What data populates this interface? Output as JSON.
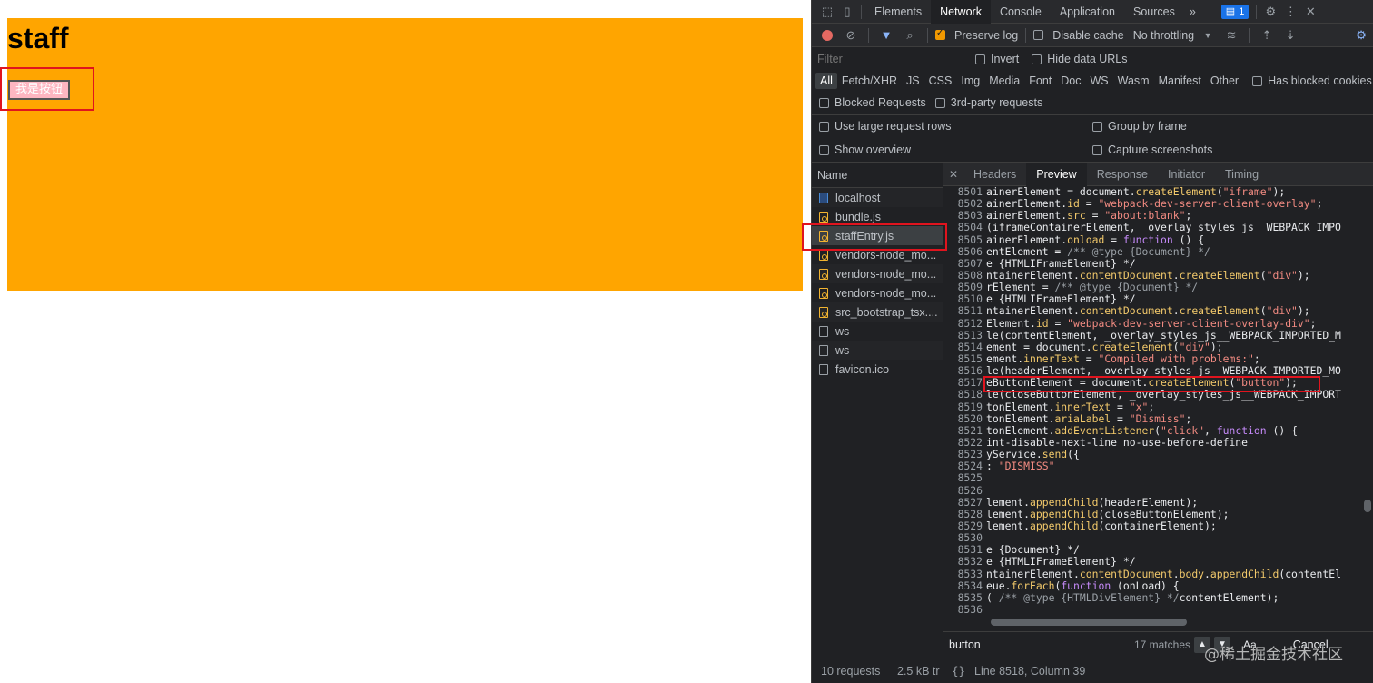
{
  "page": {
    "title": "staff",
    "button_label": "我是按钮"
  },
  "devtools": {
    "tabs": [
      "Elements",
      "Network",
      "Console",
      "Application",
      "Sources"
    ],
    "active_tab": "Network",
    "more_tabs_label": "»",
    "issues_count": "1",
    "toolbar": {
      "preserve_log": "Preserve log",
      "disable_cache": "Disable cache",
      "throttling": "No throttling"
    },
    "filter": {
      "placeholder": "Filter",
      "invert": "Invert",
      "hide_data_urls": "Hide data URLs"
    },
    "types": [
      "All",
      "Fetch/XHR",
      "JS",
      "CSS",
      "Img",
      "Media",
      "Font",
      "Doc",
      "WS",
      "Wasm",
      "Manifest",
      "Other"
    ],
    "has_blocked_cookies": "Has blocked cookies",
    "blocked_requests": "Blocked Requests",
    "third_party": "3rd-party requests",
    "options": {
      "large_rows": "Use large request rows",
      "group_by_frame": "Group by frame",
      "show_overview": "Show overview",
      "capture_screenshots": "Capture screenshots"
    },
    "name_header": "Name",
    "requests": [
      {
        "name": "localhost",
        "type": "doc"
      },
      {
        "name": "bundle.js",
        "type": "js"
      },
      {
        "name": "staffEntry.js",
        "type": "js"
      },
      {
        "name": "vendors-node_mo...",
        "type": "js"
      },
      {
        "name": "vendors-node_mo...",
        "type": "js"
      },
      {
        "name": "vendors-node_mo...",
        "type": "js"
      },
      {
        "name": "src_bootstrap_tsx....",
        "type": "js"
      },
      {
        "name": "ws",
        "type": "other"
      },
      {
        "name": "ws",
        "type": "other"
      },
      {
        "name": "favicon.ico",
        "type": "other"
      }
    ],
    "preview_tabs": [
      "Headers",
      "Preview",
      "Response",
      "Initiator",
      "Timing"
    ],
    "active_preview_tab": "Preview",
    "code_lines": [
      {
        "n": "8501",
        "t": "ainerElement = document.createElement(\"iframe\");"
      },
      {
        "n": "8502",
        "t": "ainerElement.id = \"webpack-dev-server-client-overlay\";"
      },
      {
        "n": "8503",
        "t": "ainerElement.src = \"about:blank\";"
      },
      {
        "n": "8504",
        "t": "(iframeContainerElement, _overlay_styles_js__WEBPACK_IMPO"
      },
      {
        "n": "8505",
        "t": "ainerElement.onload = function () {"
      },
      {
        "n": "8506",
        "t": "entElement = /** @type {Document} */"
      },
      {
        "n": "8507",
        "t": "e {HTMLIFrameElement} */"
      },
      {
        "n": "8508",
        "t": "ntainerElement.contentDocument.createElement(\"div\");"
      },
      {
        "n": "8509",
        "t": "rElement = /** @type {Document} */"
      },
      {
        "n": "8510",
        "t": "e {HTMLIFrameElement} */"
      },
      {
        "n": "8511",
        "t": "ntainerElement.contentDocument.createElement(\"div\");"
      },
      {
        "n": "8512",
        "t": "Element.id = \"webpack-dev-server-client-overlay-div\";"
      },
      {
        "n": "8513",
        "t": "le(contentElement, _overlay_styles_js__WEBPACK_IMPORTED_M"
      },
      {
        "n": "8514",
        "t": "ement = document.createElement(\"div\");"
      },
      {
        "n": "8515",
        "t": "ement.innerText = \"Compiled with problems:\";"
      },
      {
        "n": "8516",
        "t": "le(headerElement, _overlay_styles_js__WEBPACK_IMPORTED_MO"
      },
      {
        "n": "8517",
        "t": "eButtonElement = document.createElement(\"button\");"
      },
      {
        "n": "8518",
        "t": "le(closeButtonElement, _overlay_styles_js__WEBPACK_IMPORT"
      },
      {
        "n": "8519",
        "t": "tonElement.innerText = \"x\";"
      },
      {
        "n": "8520",
        "t": "tonElement.ariaLabel = \"Dismiss\";"
      },
      {
        "n": "8521",
        "t": "tonElement.addEventListener(\"click\", function () {"
      },
      {
        "n": "8522",
        "t": "int-disable-next-line no-use-before-define"
      },
      {
        "n": "8523",
        "t": "yService.send({"
      },
      {
        "n": "8524",
        "t": ": \"DISMISS\""
      },
      {
        "n": "8525",
        "t": ""
      },
      {
        "n": "8526",
        "t": ""
      },
      {
        "n": "8527",
        "t": "lement.appendChild(headerElement);"
      },
      {
        "n": "8528",
        "t": "lement.appendChild(closeButtonElement);"
      },
      {
        "n": "8529",
        "t": "lement.appendChild(containerElement);"
      },
      {
        "n": "8530",
        "t": ""
      },
      {
        "n": "8531",
        "t": "e {Document} */"
      },
      {
        "n": "8532",
        "t": "e {HTMLIFrameElement} */"
      },
      {
        "n": "8533",
        "t": "ntainerElement.contentDocument.body.appendChild(contentEl"
      },
      {
        "n": "8534",
        "t": "eue.forEach(function (onLoad) {"
      },
      {
        "n": "8535",
        "t": "( /** @type {HTMLDivElement} */contentElement);"
      },
      {
        "n": "8536",
        "t": ""
      }
    ],
    "search": {
      "value": "button",
      "matches": "17 matches",
      "case_label": "Aa",
      "cancel": "Cancel"
    },
    "status": {
      "requests": "10 requests",
      "transferred": "2.5 kB tr",
      "braces": "{}",
      "position": "Line 8518, Column 39"
    }
  },
  "watermark": "@稀土掘金技术社区",
  "colors": {
    "orange": "#ffa500",
    "highlight_red": "#e0141e",
    "devtools_bg": "#202124"
  }
}
